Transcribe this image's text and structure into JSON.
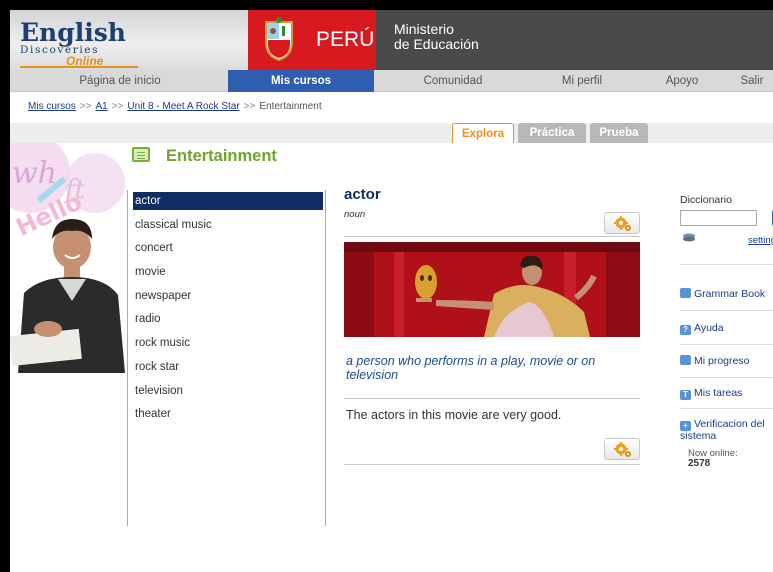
{
  "logo": {
    "word1": "English",
    "word2": "Discoveries",
    "word3": "Online"
  },
  "peru": {
    "label": "PERÚ"
  },
  "ministerio": {
    "line1": "Ministerio",
    "line2": "de Educación"
  },
  "nav": {
    "items": [
      {
        "label": "Página de inicio"
      },
      {
        "label": "Mis cursos"
      },
      {
        "label": "Comunidad"
      },
      {
        "label": "Mi perfil"
      },
      {
        "label": "Apoyo"
      },
      {
        "label": "Salir"
      }
    ],
    "active": "Mis cursos"
  },
  "breadcrumb": {
    "items": [
      "Mis cursos",
      "A1",
      "Unit 8 - Meet A Rock Star",
      "Entertainment"
    ],
    "separator": ">>"
  },
  "tabs": [
    {
      "label": "Explora"
    },
    {
      "label": "Práctica"
    },
    {
      "label": "Prueba"
    }
  ],
  "page": {
    "title": "Entertainment"
  },
  "words": [
    "actor",
    "classical music",
    "concert",
    "movie",
    "newspaper",
    "radio",
    "rock music",
    "rock star",
    "television",
    "theater"
  ],
  "selected_word": "actor",
  "entry": {
    "word": "actor",
    "part_of_speech": "noun",
    "definition": "a person who performs in a play, movie or on television",
    "example": "The actors in this movie are very good."
  },
  "sidebar": {
    "dictionary_label": "Diccionario",
    "dictionary_value": "",
    "settings_label": "settings",
    "links": [
      {
        "label": "Grammar Book"
      },
      {
        "label": "Ayuda"
      },
      {
        "label": "Mi progreso"
      },
      {
        "label": "Mis tareas"
      },
      {
        "label": "Verificacion del sistema"
      }
    ],
    "online_label": "Now online:",
    "online_count": "2578"
  },
  "colors": {
    "nav_active": "#2f5eb0",
    "accent_green": "#6fa52e",
    "accent_orange": "#f09020",
    "peru_red": "#d71920"
  }
}
